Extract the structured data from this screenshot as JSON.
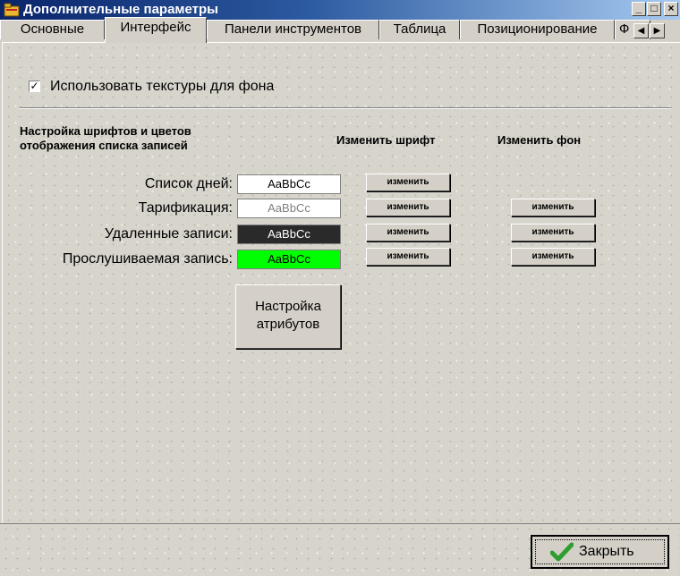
{
  "window": {
    "title": "Дополнительные параметры"
  },
  "titlebar_buttons": {
    "minimize": "_",
    "maximize": "□",
    "close": "×"
  },
  "tabs": [
    {
      "label": "Основные"
    },
    {
      "label": "Интерфейс"
    },
    {
      "label": "Панели инструментов"
    },
    {
      "label": "Таблица"
    },
    {
      "label": "Позиционирование"
    },
    {
      "label": "Ф"
    }
  ],
  "tab_scroll": {
    "left": "◀",
    "right": "▶"
  },
  "texture_option": {
    "label": "Использовать текстуры для фона",
    "checked": true,
    "mark": "✓"
  },
  "headings": {
    "section_line1": "Настройка шрифтов и цветов",
    "section_line2": "отображения списка записей",
    "change_font": "Изменить шрифт",
    "change_background": "Изменить фон"
  },
  "rows": [
    {
      "label": "Список дней:",
      "sample": "AaBbCc",
      "fg": "#000000",
      "bg": "#ffffff",
      "font_button": "изменить",
      "bg_button": ""
    },
    {
      "label": "Тарификация:",
      "sample": "AaBbCc",
      "fg": "#808080",
      "bg": "#ffffff",
      "font_button": "изменить",
      "bg_button": "изменить"
    },
    {
      "label": "Удаленные записи:",
      "sample": "AaBbCc",
      "fg": "#ffffff",
      "bg": "#2a2a2a",
      "font_button": "изменить",
      "bg_button": "изменить"
    },
    {
      "label": "Прослушиваемая запись:",
      "sample": "AaBbCc",
      "fg": "#000000",
      "bg": "#00ff00",
      "font_button": "изменить",
      "bg_button": "изменить"
    }
  ],
  "attributes_button": {
    "line1": "Настройка",
    "line2": "атрибутов"
  },
  "close_button": {
    "label": "Закрыть"
  },
  "colors": {
    "title_start": "#0a246a",
    "title_end": "#a6caf0",
    "check_green": "#2e9e2e"
  }
}
